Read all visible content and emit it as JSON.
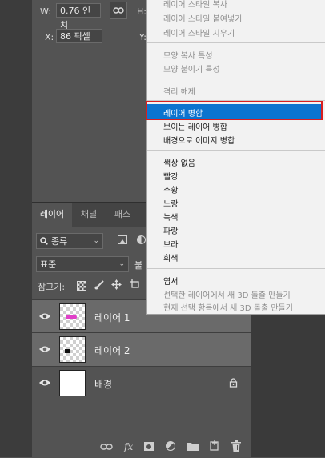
{
  "properties": {
    "w_label": "W:",
    "w_value": "0.76 인치",
    "h_label": "H:",
    "x_label": "X:",
    "x_value": "86 픽셀",
    "y_label": "Y:"
  },
  "layers_panel": {
    "tabs": [
      "레이어",
      "채널",
      "패스"
    ],
    "filter_kind": "종류",
    "blend_mode": "표준",
    "opacity_label": "불",
    "lock_label": "잠그기:",
    "layers": [
      {
        "name": "레이어 1",
        "selected": true,
        "thumb": "transparent-pink"
      },
      {
        "name": "레이어 2",
        "selected": true,
        "thumb": "transparent-black"
      },
      {
        "name": "배경",
        "selected": false,
        "thumb": "white",
        "locked": true
      }
    ],
    "fx_label": "fx"
  },
  "context_menu": {
    "items": [
      {
        "label": "레이어 스타일 복사",
        "disabled": true
      },
      {
        "label": "레이어 스타일 붙여넣기",
        "disabled": true
      },
      {
        "label": "레이어 스타일 지우기",
        "disabled": true
      },
      {
        "label": "모양 복사 특성",
        "disabled": true
      },
      {
        "label": "모양 붙이기 특성",
        "disabled": true
      },
      {
        "label": "격리 해제",
        "disabled": true
      },
      {
        "label": "레이어 병합",
        "disabled": false,
        "highlighted": true
      },
      {
        "label": "보이는 레이어 병합",
        "disabled": false
      },
      {
        "label": "배경으로 이미지 병합",
        "disabled": false
      },
      {
        "label": "색상 없음",
        "disabled": false
      },
      {
        "label": "빨강",
        "disabled": false
      },
      {
        "label": "주황",
        "disabled": false
      },
      {
        "label": "노랑",
        "disabled": false
      },
      {
        "label": "녹색",
        "disabled": false
      },
      {
        "label": "파랑",
        "disabled": false
      },
      {
        "label": "보라",
        "disabled": false
      },
      {
        "label": "회색",
        "disabled": false
      },
      {
        "label": "엽서",
        "disabled": false
      },
      {
        "label": "선택한 레이어에서 새 3D 돌출 만들기",
        "disabled": true
      },
      {
        "label": "현재 선택 항목에서 새 3D 돌출 만들기",
        "disabled": true
      }
    ]
  },
  "colors": {
    "highlight": "#0b74cf",
    "annotation_box": "#d81e1e",
    "layer1_content": "#e040c8"
  }
}
